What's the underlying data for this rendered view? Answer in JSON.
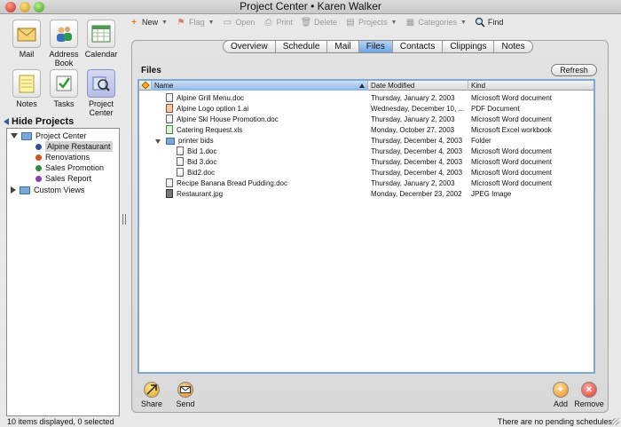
{
  "window": {
    "title": "Project Center • Karen Walker"
  },
  "apps": [
    {
      "label": "Mail",
      "icon": "mail-icon"
    },
    {
      "label": "Address Book",
      "icon": "address-book-icon"
    },
    {
      "label": "Calendar",
      "icon": "calendar-icon"
    },
    {
      "label": "Notes",
      "icon": "notes-icon"
    },
    {
      "label": "Tasks",
      "icon": "tasks-icon"
    },
    {
      "label": "Project Center",
      "icon": "project-center-icon"
    }
  ],
  "sidebar": {
    "hide_projects_label": "Hide Projects",
    "tree": {
      "root_label": "Project Center",
      "projects": [
        {
          "label": "Alpine Restaurant",
          "color": "#2d4f9e"
        },
        {
          "label": "Renovations",
          "color": "#d4521d"
        },
        {
          "label": "Sales Promotion",
          "color": "#2f8f3a"
        },
        {
          "label": "Sales Report",
          "color": "#8a3fb0"
        }
      ],
      "custom_views_label": "Custom Views"
    }
  },
  "toolbar": {
    "new_label": "New",
    "flag_label": "Flag",
    "open_label": "Open",
    "print_label": "Print",
    "delete_label": "Delete",
    "projects_label": "Projects",
    "categories_label": "Categories",
    "find_label": "Find"
  },
  "tabs": [
    "Overview",
    "Schedule",
    "Mail",
    "Files",
    "Contacts",
    "Clippings",
    "Notes"
  ],
  "files": {
    "heading": "Files",
    "refresh_label": "Refresh",
    "columns": {
      "name": "Name",
      "date_modified": "Date Modified",
      "kind": "Kind"
    },
    "rows": [
      {
        "name": "Alpine Grill Menu.doc",
        "date": "Thursday, January 2, 2003",
        "kind": "Microsoft Word document",
        "type": "doc",
        "indent": 0
      },
      {
        "name": "Alpine Logo option 1.ai",
        "date": "Wednesday, December 10, ...",
        "kind": "PDF Document",
        "type": "pdf",
        "indent": 0
      },
      {
        "name": "Alpine Ski House Promotion.doc",
        "date": "Thursday, January 2, 2003",
        "kind": "Microsoft Word document",
        "type": "doc",
        "indent": 0
      },
      {
        "name": "Catering Request.xls",
        "date": "Monday, October 27, 2003",
        "kind": "Microsoft Excel workbook",
        "type": "xls",
        "indent": 0
      },
      {
        "name": "printer bids",
        "date": "Thursday, December 4, 2003",
        "kind": "Folder",
        "type": "folder",
        "indent": 0
      },
      {
        "name": "Bid 1.doc",
        "date": "Thursday, December 4, 2003",
        "kind": "Microsoft Word document",
        "type": "doc",
        "indent": 1
      },
      {
        "name": "Bid 3.doc",
        "date": "Thursday, December 4, 2003",
        "kind": "Microsoft Word document",
        "type": "doc",
        "indent": 1
      },
      {
        "name": "Bid2.doc",
        "date": "Thursday, December 4, 2003",
        "kind": "Microsoft Word document",
        "type": "doc",
        "indent": 1
      },
      {
        "name": "Recipe Banana Bread Pudding.doc",
        "date": "Thursday, January 2, 2003",
        "kind": "Microsoft Word document",
        "type": "doc",
        "indent": 0
      },
      {
        "name": "Restaurant.jpg",
        "date": "Monday, December 23, 2002",
        "kind": "JPEG Image",
        "type": "img",
        "indent": 0
      }
    ]
  },
  "actions": {
    "share_label": "Share",
    "send_label": "Send",
    "add_label": "Add",
    "remove_label": "Remove"
  },
  "status": {
    "left": "10 items displayed, 0 selected",
    "right": "There are no pending schedules"
  }
}
